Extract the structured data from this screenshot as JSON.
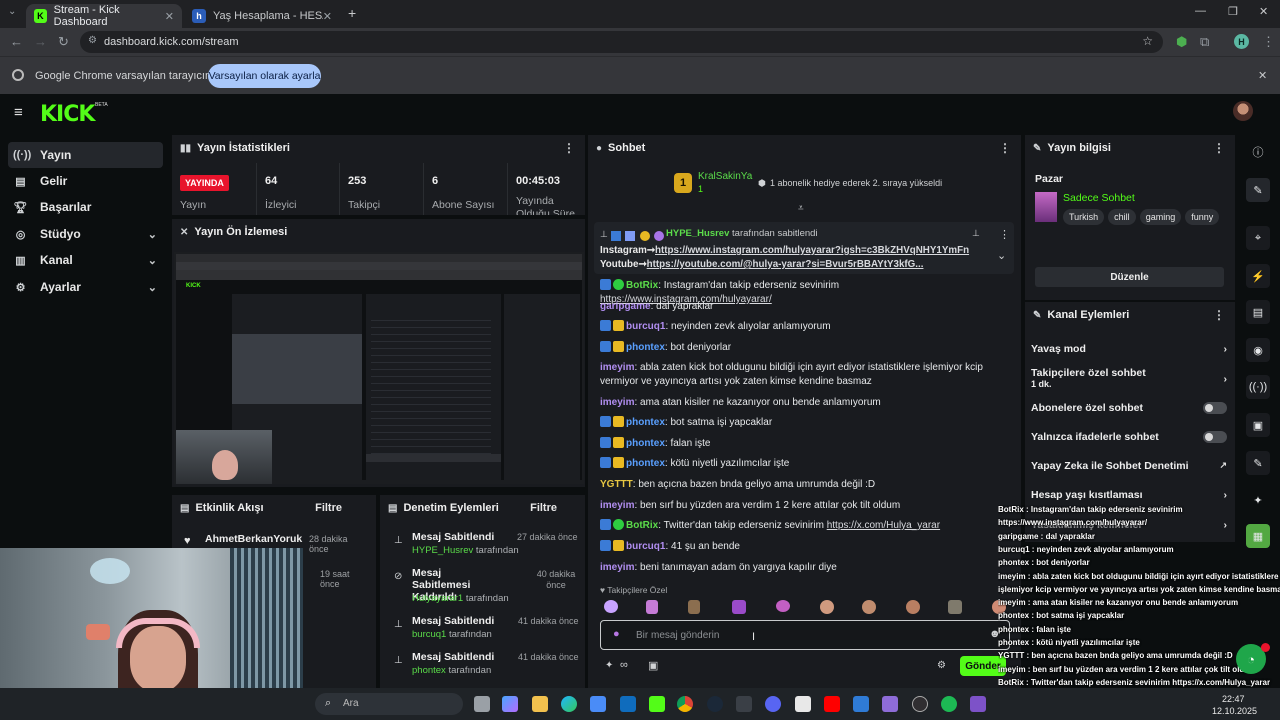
{
  "browser": {
    "tabs": [
      {
        "title": "Stream - Kick Dashboard",
        "active": true
      },
      {
        "title": "Yaş Hesaplama - HESAPLAMA.N",
        "active": false
      }
    ],
    "url": "dashboard.kick.com/stream",
    "infobar_text": "Google Chrome varsayılan tarayıcınız değil",
    "infobar_button": "Varsayılan olarak ayarla",
    "profile_initial": "H"
  },
  "sidebar": {
    "items": [
      {
        "label": "Yayın",
        "icon": "broadcast-icon",
        "active": true
      },
      {
        "label": "Gelir",
        "icon": "revenue-icon"
      },
      {
        "label": "Başarılar",
        "icon": "trophy-icon"
      },
      {
        "label": "Stüdyo",
        "icon": "studio-icon",
        "chevron": true
      },
      {
        "label": "Kanal",
        "icon": "channel-icon",
        "chevron": true
      },
      {
        "label": "Ayarlar",
        "icon": "gear-icon",
        "chevron": true
      }
    ]
  },
  "stats": {
    "title": "Yayın İstatistikleri",
    "live_badge": "YAYINDA",
    "live_label": "Yayın",
    "cells": [
      {
        "value": "64",
        "label": "İzleyici"
      },
      {
        "value": "253",
        "label": "Takipçi"
      },
      {
        "value": "6",
        "label": "Abone Sayısı"
      },
      {
        "value": "00:45:03",
        "label": "Yayında Olduğu Süre"
      }
    ]
  },
  "preview": {
    "title": "Yayın Ön İzlemesi"
  },
  "activity": {
    "title": "Etkinlik Akışı",
    "filter": "Filtre",
    "items": [
      {
        "name": "AhmetBerkanYoruk",
        "time": "28 dakika önce"
      },
      {
        "name": "",
        "time": "19 saat önce"
      }
    ]
  },
  "moderation": {
    "title": "Denetim Eylemleri",
    "filter": "Filtre",
    "items": [
      {
        "action": "Mesaj Sabitlendi",
        "user": "HYPE_Husrev",
        "suffix": "tarafından",
        "time": "27 dakika önce"
      },
      {
        "action": "Mesaj Sabitlemesi Kaldırıldı",
        "user": "Hulyayarar1",
        "suffix": "tarafından",
        "time": "40 dakika önce"
      },
      {
        "action": "Mesaj Sabitlendi",
        "user": "burcuq1",
        "suffix": "tarafından",
        "time": "41 dakika önce"
      },
      {
        "action": "Mesaj Sabitlendi",
        "user": "phontex",
        "suffix": "tarafından",
        "time": "41 dakika önce"
      }
    ]
  },
  "chat": {
    "title": "Sohbet",
    "gift_user": "KralSakinYa",
    "gift_count": "1",
    "gift_text": "1 abonelik hediye ederek 2. sıraya yükseldi",
    "pinned": {
      "by_user": "HYPE_Husrev",
      "by_suffix": "tarafından sabitlendi",
      "line1_prefix": "Instagram➞",
      "line1_link": "https://www.instagram.com/hulyayarar?igsh=c3BkZHVqNHY1YmFn",
      "line2_prefix": "Youtube➞",
      "line2_link": "https://youtube.com/@hulya-yarar?si=Bvur5rBBAYtY3kfG..."
    },
    "messages": [
      {
        "user": "BotRix",
        "ucolor": "u-green",
        "badges": [
          "b-blue",
          "b-green"
        ],
        "text": ": Instagram'dan takip ederseniz sevinirim ",
        "link": "https://www.instagram.com/hulyayarar/"
      },
      {
        "user": "garipgame",
        "ucolor": "u-purple",
        "badges": [],
        "text": ": dal yapraklar"
      },
      {
        "user": "burcuq1",
        "ucolor": "u-purple",
        "badges": [
          "b-blue",
          "b-gold"
        ],
        "text": ": neyinden zevk alıyolar anlamıyorum"
      },
      {
        "user": "phontex",
        "ucolor": "u-blue",
        "badges": [
          "b-blue",
          "b-gold"
        ],
        "text": ": bot deniyorlar"
      },
      {
        "user": "imeyim",
        "ucolor": "u-purple",
        "badges": [],
        "text": ": abla zaten kick bot oldugunu bildiği için ayırt ediyor istatistiklere işlemiyor kcip vermiyor ve yayıncıya artısı yok zaten kimse kendine basmaz"
      },
      {
        "user": "imeyim",
        "ucolor": "u-purple",
        "badges": [],
        "text": ": ama atan kisiler ne kazanıyor onu bende anlamıyorum"
      },
      {
        "user": "phontex",
        "ucolor": "u-blue",
        "badges": [
          "b-blue",
          "b-gold"
        ],
        "text": ": bot satma işi yapcaklar"
      },
      {
        "user": "phontex",
        "ucolor": "u-blue",
        "badges": [
          "b-blue",
          "b-gold"
        ],
        "text": ": falan işte"
      },
      {
        "user": "phontex",
        "ucolor": "u-blue",
        "badges": [
          "b-blue",
          "b-gold"
        ],
        "text": ": kötü niyetli yazılımcılar işte"
      },
      {
        "user": "YGTTT",
        "ucolor": "u-yellow",
        "badges": [],
        "text": ": ben açıcna bazen bnda geliyo ama umrumda değil :D"
      },
      {
        "user": "imeyim",
        "ucolor": "u-purple",
        "badges": [],
        "text": ": ben sırf bu yüzden ara verdim 1 2 kere attılar çok tilt oldum"
      },
      {
        "user": "BotRix",
        "ucolor": "u-green",
        "badges": [
          "b-blue",
          "b-green"
        ],
        "text": ": Twitter'dan takip ederseniz sevinirim ",
        "link": "https://x.com/Hulya_yarar"
      },
      {
        "user": "burcuq1",
        "ucolor": "u-purple",
        "badges": [
          "b-blue",
          "b-gold"
        ],
        "text": ": 41 şu an bende"
      },
      {
        "user": "imeyim",
        "ucolor": "u-purple",
        "badges": [],
        "text": ": beni tanımayan adam ön yargıya kapılır diye"
      }
    ],
    "followers_only": "Takipçilere Özel",
    "input_placeholder": "Bir mesaj gönderin",
    "send_button": "Gönder"
  },
  "stream_info": {
    "title": "Yayın bilgisi",
    "category_label": "Pazar",
    "stream_title": "Sadece Sohbet",
    "tags": [
      "Turkish",
      "chill",
      "gaming",
      "funny"
    ],
    "edit_button": "Düzenle"
  },
  "channel_actions": {
    "title": "Kanal Eylemleri",
    "rows": [
      {
        "label": "Yavaş mod",
        "control": "chevron"
      },
      {
        "label": "Takipçilere özel sohbet",
        "sub": "1 dk.",
        "control": "chevron"
      },
      {
        "label": "Abonelere özel sohbet",
        "control": "toggle"
      },
      {
        "label": "Yalnızca ifadelerle sohbet",
        "control": "toggle"
      },
      {
        "label": "Yapay Zeka ile Sohbet Denetimi",
        "control": "external"
      },
      {
        "label": "Hesap yaşı kısıtlaması",
        "control": "chevron"
      },
      {
        "label": "Yasaklanmış kelimeler",
        "control": "chevron"
      }
    ]
  },
  "overlay_chat": [
    "BotRix : Instagram'dan takip ederseniz sevinirim",
    "https://www.instagram.com/hulyayarar/",
    "garipgame : dal yapraklar",
    "burcuq1 : neyinden zevk alıyolar anlamıyorum",
    "phontex : bot deniyorlar",
    "imeyim : abla zaten kick bot oldugunu bildiği için ayırt ediyor istatistiklere",
    "işlemiyor kcip vermiyor ve yayıncıya artısı yok zaten kimse kendine basmaz",
    "imeyim : ama atan kisiler ne kazanıyor onu bende anlamıyorum",
    "phontex : bot satma işi yapcaklar",
    "phontex : falan işte",
    "phontex : kötü niyetli yazılımcılar işte",
    "YGTTT : ben açıcna bazen bnda geliyo ama umrumda değil :D",
    "imeyim : ben sırf bu yüzden ara verdim 1 2 kere attılar çok tilt oldum",
    "BotRix : Twitter'dan takip ederseniz sevinirim https://x.com/Hulya_yarar",
    "burcuq1 : 41 şu an bende",
    "imeyim : beni tanımayan adam ön yargıya kapılır diye"
  ],
  "taskbar": {
    "search_placeholder": "Ara",
    "time": "22:47",
    "date": "12.10.2025"
  },
  "colors": {
    "kick_green": "#53fc18",
    "live_red": "#e8142c",
    "panel_bg": "#191b1f",
    "page_bg": "#0b0e0f"
  }
}
